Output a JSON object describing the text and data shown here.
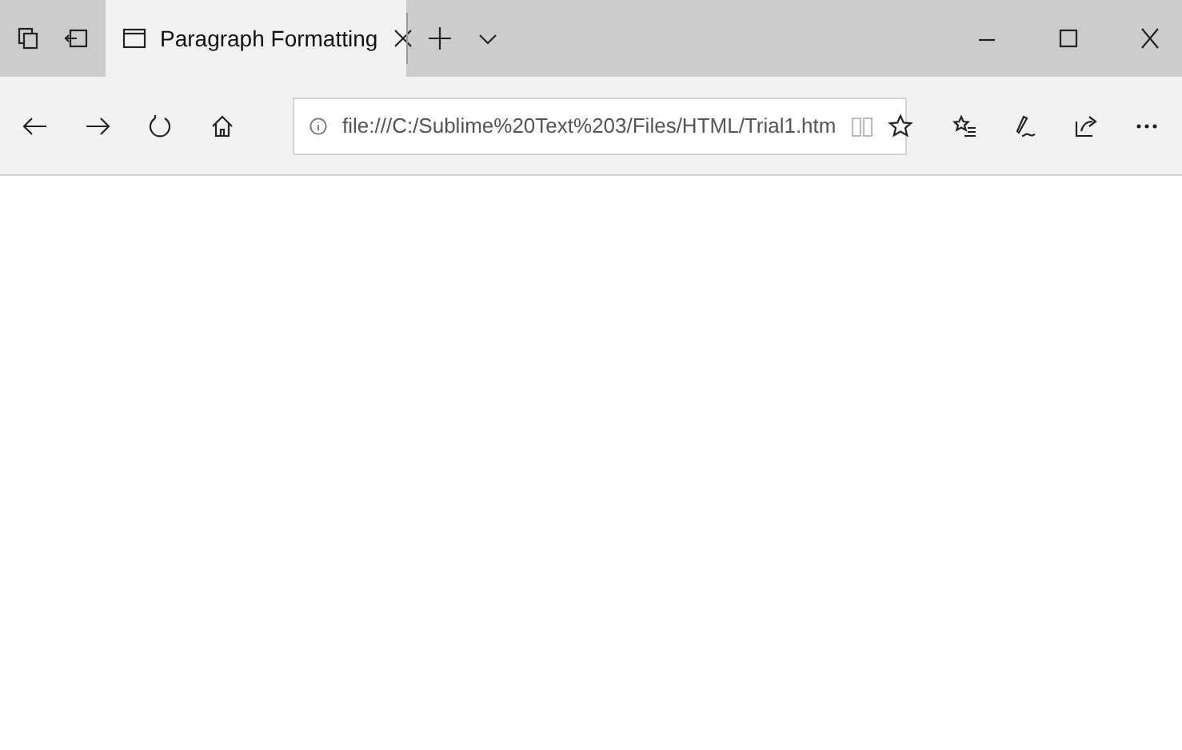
{
  "tabs": [
    {
      "title": "Paragraph Formatting",
      "selected": true
    }
  ],
  "address_bar": {
    "value": "file:///C:/Sublime%20Text%203/Files/HTML/Trial1.htm"
  }
}
